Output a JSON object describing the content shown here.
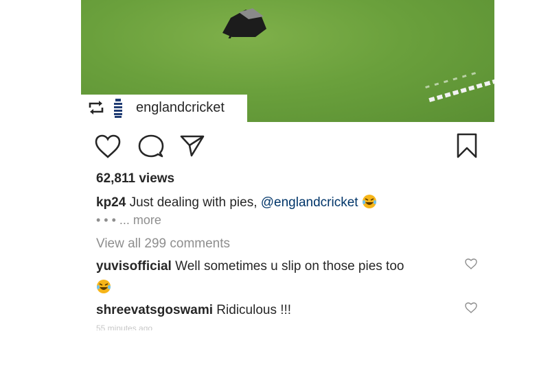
{
  "post": {
    "credit_username": "englandcricket",
    "views": "62,811 views",
    "caption": {
      "username": "kp24",
      "text": " Just dealing with pies, ",
      "mention": "@englandcricket"
    },
    "more_label": "• • • ... more",
    "view_all_comments": "View all 299 comments",
    "comments": [
      {
        "username": "yuvisofficial",
        "text": " Well sometimes u slip on those pies too"
      },
      {
        "username": "shreevatsgoswami",
        "text": " Ridiculous !!!"
      }
    ],
    "timestamp": "55 minutes ago"
  },
  "icons": {
    "like": "heart-icon",
    "comment": "comment-bubble-icon",
    "share": "paper-plane-icon",
    "save": "bookmark-icon",
    "repost": "repost-icon",
    "emoji": "laughing-tears-emoji"
  },
  "colors": {
    "text": "#262626",
    "muted": "#8e8e8e",
    "link": "#003569",
    "grass": "#6aa03c"
  }
}
